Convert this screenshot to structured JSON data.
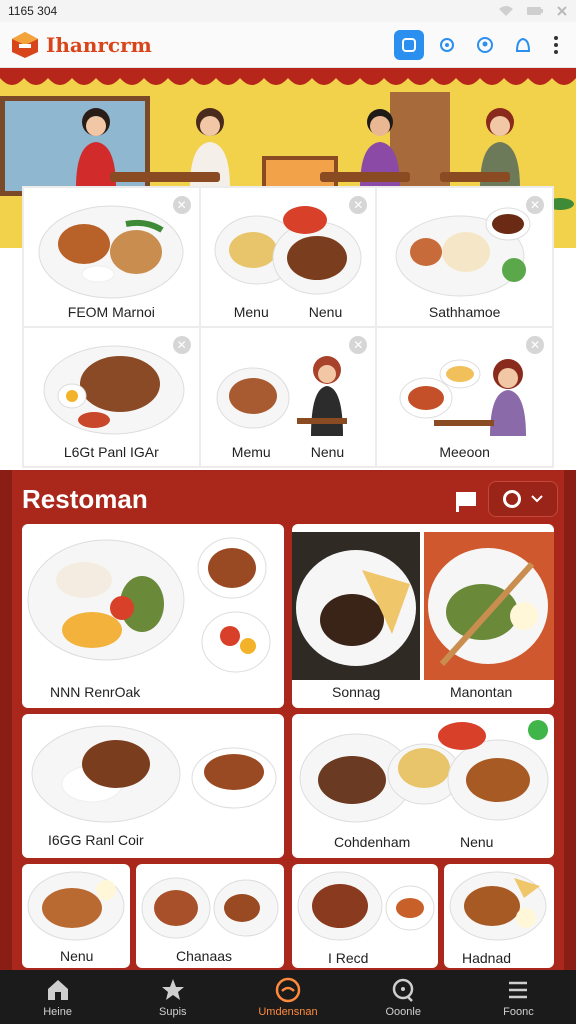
{
  "status_bar": {
    "time": "1165 304",
    "icons": [
      "wifi-icon",
      "battery-icon",
      "close-icon"
    ]
  },
  "app_bar": {
    "title": "Ihanrcrm",
    "actions": [
      "home-action-icon",
      "settings-icon",
      "pin-icon",
      "account-icon",
      "more-icon"
    ],
    "accent": "#2b8ff0"
  },
  "hero": {
    "scene": "restaurant-dining-illustration"
  },
  "top_panel": {
    "cards": [
      {
        "label": "FEOM Marnoi"
      },
      {
        "label_left": "Menu",
        "label_right": "Nenu"
      },
      {
        "label": "Sathhamoe"
      },
      {
        "label": "L6Gt Panl IGAr"
      },
      {
        "label_left": "Memu",
        "label_right": "Nenu"
      },
      {
        "label": "Meeoon"
      }
    ]
  },
  "resto": {
    "title": "Restoman",
    "colors": {
      "background": "#a9281b",
      "dark": "#8a1e14"
    },
    "cards": [
      {
        "label": "NNN RenrOak"
      },
      {
        "label_left": "Sonnag",
        "label_right": "Manontan"
      },
      {
        "label": "I6GG Ranl Coir"
      },
      {
        "label_left": "Cohdenham",
        "label_right": "Nenu"
      },
      {
        "label": "Nenu"
      },
      {
        "label": "Chanaas"
      },
      {
        "label": "I Recd"
      },
      {
        "label": "Hadnad"
      }
    ]
  },
  "tab_bar": {
    "tabs": [
      {
        "label": "Heine",
        "icon": "home-icon"
      },
      {
        "label": "Supis",
        "icon": "star-icon"
      },
      {
        "label": "Umdensnan",
        "icon": "restaurant-icon",
        "active": true
      },
      {
        "label": "Ooonle",
        "icon": "search-icon"
      },
      {
        "label": "Foonc",
        "icon": "menu-icon"
      }
    ],
    "active_color": "#ff8a3d"
  }
}
